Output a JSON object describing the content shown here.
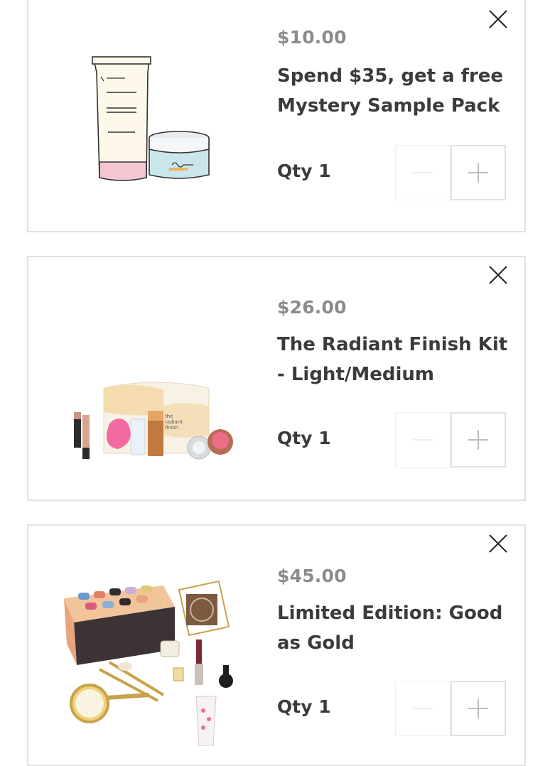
{
  "cart": {
    "items": [
      {
        "price": "$10.00",
        "title": "Spend $35, get a free Mystery Sample Pack",
        "qty_label": "Qty 1",
        "thumbnail": "mystery-sample-pack-illustration",
        "actions": {
          "remove": "close-icon",
          "decrease": "minus-icon",
          "increase": "plus-icon"
        }
      },
      {
        "price": "$26.00",
        "title": "The Radiant Finish Kit - Light/Medium",
        "qty_label": "Qty 1",
        "thumbnail": "radiant-finish-kit-photo",
        "actions": {
          "remove": "close-icon",
          "decrease": "minus-icon",
          "increase": "plus-icon"
        }
      },
      {
        "price": "$45.00",
        "title": "Limited Edition: Good as Gold",
        "qty_label": "Qty 1",
        "thumbnail": "good-as-gold-set-photo",
        "actions": {
          "remove": "close-icon",
          "decrease": "minus-icon",
          "increase": "plus-icon"
        }
      }
    ]
  },
  "colors": {
    "card_border": "#e1e1e1",
    "price_text": "#8b8b8b",
    "title_text": "#3b3b3b"
  }
}
